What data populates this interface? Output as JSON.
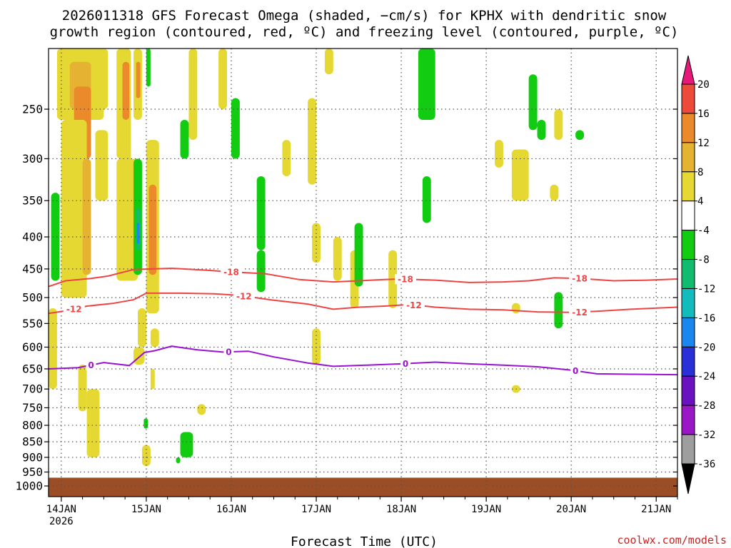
{
  "chart_data": {
    "type": "heatmap",
    "title": "2026011318 GFS Forecast Omega (shaded, −cm/s) for KPHX with dendritic snow",
    "title_line2": "growth region (contoured, red, ºC) and freezing level (contoured, purple, ºC)",
    "xlabel": "Forecast Time (UTC)",
    "credit": "coolwx.com/models",
    "y_scale": "log-pressure",
    "y_direction": "decreasing-upward",
    "ylim": [
      1040,
      200
    ],
    "xlim": [
      -0.15,
      7.25
    ],
    "grid": "dotted",
    "y_ticks": [
      250,
      300,
      350,
      400,
      450,
      500,
      550,
      600,
      650,
      700,
      750,
      800,
      850,
      900,
      950,
      1000
    ],
    "y_tick_labels": [
      "250",
      "300",
      "350",
      "400",
      "450",
      "500",
      "550",
      "600",
      "650",
      "700",
      "750",
      "800",
      "850",
      "900",
      "950",
      "1000"
    ],
    "x_ticks": [
      0,
      1,
      2,
      3,
      4,
      5,
      6,
      7
    ],
    "x_tick_labels": [
      "14JAN",
      "15JAN",
      "16JAN",
      "17JAN",
      "18JAN",
      "19JAN",
      "20JAN",
      "21JAN"
    ],
    "x_year_label": "2026",
    "colorbar": {
      "levels": [
        -36,
        -32,
        -28,
        -24,
        -20,
        -16,
        -12,
        -8,
        -4,
        4,
        8,
        12,
        16,
        20
      ],
      "labels": [
        "-36",
        "-32",
        "-28",
        "-24",
        "-20",
        "-16",
        "-12",
        "-8",
        "-4",
        "4",
        "8",
        "12",
        "16",
        "20"
      ],
      "colors": [
        "#9e9e9e",
        "#9a16c6",
        "#6a12c0",
        "#2a30d8",
        "#1a86ee",
        "#12bcbc",
        "#12bc6e",
        "#12cc12",
        "#ffffff",
        "#e6d832",
        "#e6b232",
        "#ea8a2a",
        "#ee4a3a"
      ],
      "under_color": "#000000",
      "over_color": "#e6187a"
    },
    "ground_color": "#9b4e26",
    "series": [
      {
        "name": "-18",
        "color": "#ee4444",
        "points": [
          [
            -0.15,
            480
          ],
          [
            0.05,
            470
          ],
          [
            0.35,
            466
          ],
          [
            0.55,
            462
          ],
          [
            0.85,
            451
          ],
          [
            1.3,
            449
          ],
          [
            1.7,
            452
          ],
          [
            2.0,
            455
          ],
          [
            2.4,
            458
          ],
          [
            2.8,
            468
          ],
          [
            3.2,
            472
          ],
          [
            3.5,
            470
          ],
          [
            3.8,
            468
          ],
          [
            4.0,
            467
          ],
          [
            4.4,
            469
          ],
          [
            4.8,
            473
          ],
          [
            5.2,
            472
          ],
          [
            5.5,
            470
          ],
          [
            5.8,
            465
          ],
          [
            6.1,
            466
          ],
          [
            6.5,
            470
          ],
          [
            6.9,
            469
          ],
          [
            7.25,
            467
          ]
        ],
        "labels_at": [
          2.0,
          4.05,
          6.1
        ]
      },
      {
        "name": "-12",
        "color": "#ee4444",
        "points": [
          [
            -0.15,
            530
          ],
          [
            0.05,
            525
          ],
          [
            0.3,
            516
          ],
          [
            0.6,
            511
          ],
          [
            0.85,
            504
          ],
          [
            1.0,
            492
          ],
          [
            1.4,
            492
          ],
          [
            1.8,
            493
          ],
          [
            2.1,
            496
          ],
          [
            2.5,
            505
          ],
          [
            2.9,
            512
          ],
          [
            3.2,
            522
          ],
          [
            3.5,
            518
          ],
          [
            3.8,
            516
          ],
          [
            4.1,
            513
          ],
          [
            4.4,
            518
          ],
          [
            4.8,
            522
          ],
          [
            5.2,
            523
          ],
          [
            5.6,
            527
          ],
          [
            6.0,
            528
          ],
          [
            6.3,
            526
          ],
          [
            6.7,
            522
          ],
          [
            7.25,
            518
          ]
        ],
        "labels_at": [
          0.15,
          2.15,
          4.15,
          6.1
        ]
      },
      {
        "name": "0",
        "color": "#9a12d2",
        "points": [
          [
            -0.15,
            650
          ],
          [
            0.2,
            647
          ],
          [
            0.5,
            635
          ],
          [
            0.8,
            642
          ],
          [
            0.98,
            612
          ],
          [
            1.1,
            608
          ],
          [
            1.3,
            598
          ],
          [
            1.6,
            606
          ],
          [
            1.9,
            611
          ],
          [
            2.2,
            609
          ],
          [
            2.5,
            622
          ],
          [
            2.9,
            636
          ],
          [
            3.2,
            644
          ],
          [
            3.6,
            641
          ],
          [
            4.0,
            638
          ],
          [
            4.4,
            634
          ],
          [
            4.8,
            638
          ],
          [
            5.2,
            641
          ],
          [
            5.6,
            645
          ],
          [
            6.0,
            653
          ],
          [
            6.3,
            662
          ],
          [
            6.7,
            663
          ],
          [
            7.25,
            664
          ]
        ],
        "labels_at": [
          0.35,
          1.97,
          4.05,
          6.05
        ]
      }
    ],
    "patches": [
      {
        "x0": -0.05,
        "x1": 0.5,
        "p0": 200,
        "p1": 260,
        "value": 5
      },
      {
        "x0": 0.1,
        "x1": 0.35,
        "p0": 210,
        "p1": 250,
        "value": 9
      },
      {
        "x0": 0.15,
        "x1": 0.35,
        "p0": 230,
        "p1": 300,
        "value": 14
      },
      {
        "x0": 0.0,
        "x1": 0.3,
        "p0": 260,
        "p1": 500,
        "value": 5
      },
      {
        "x0": 0.25,
        "x1": 0.35,
        "p0": 300,
        "p1": 460,
        "value": 9
      },
      {
        "x0": -0.12,
        "x1": -0.02,
        "p0": 340,
        "p1": 470,
        "value": -6
      },
      {
        "x0": -0.15,
        "x1": -0.05,
        "p0": 520,
        "p1": 700,
        "value": 5
      },
      {
        "x0": 0.2,
        "x1": 0.3,
        "p0": 640,
        "p1": 760,
        "value": 5
      },
      {
        "x0": 0.4,
        "x1": 0.55,
        "p0": 270,
        "p1": 350,
        "value": 5
      },
      {
        "x0": 0.45,
        "x1": 0.55,
        "p0": 200,
        "p1": 250,
        "value": 6
      },
      {
        "x0": 0.65,
        "x1": 0.75,
        "p0": 200,
        "p1": 300,
        "value": 6
      },
      {
        "x0": 0.7,
        "x1": 0.82,
        "p0": 200,
        "p1": 350,
        "value": 6
      },
      {
        "x0": 0.72,
        "x1": 0.8,
        "p0": 210,
        "p1": 260,
        "value": 15
      },
      {
        "x0": 0.85,
        "x1": 0.95,
        "p0": 200,
        "p1": 260,
        "value": 6
      },
      {
        "x0": 0.88,
        "x1": 0.93,
        "p0": 210,
        "p1": 240,
        "value": 15
      },
      {
        "x0": 0.65,
        "x1": 0.9,
        "p0": 300,
        "p1": 470,
        "value": 5
      },
      {
        "x0": 0.85,
        "x1": 0.95,
        "p0": 300,
        "p1": 460,
        "value": -6
      },
      {
        "x0": 0.88,
        "x1": 0.93,
        "p0": 360,
        "p1": 420,
        "value": -10
      },
      {
        "x0": 0.89,
        "x1": 0.92,
        "p0": 380,
        "p1": 410,
        "value": -18
      },
      {
        "x0": 1.0,
        "x1": 1.15,
        "p0": 280,
        "p1": 530,
        "value": 6
      },
      {
        "x0": 1.03,
        "x1": 1.12,
        "p0": 330,
        "p1": 460,
        "value": 14
      },
      {
        "x0": 0.9,
        "x1": 1.0,
        "p0": 520,
        "p1": 600,
        "value": 5
      },
      {
        "x0": 0.85,
        "x1": 0.98,
        "p0": 600,
        "p1": 640,
        "value": 5
      },
      {
        "x0": 1.05,
        "x1": 1.1,
        "p0": 650,
        "p1": 700,
        "value": 5
      },
      {
        "x0": 1.0,
        "x1": 1.05,
        "p0": 200,
        "p1": 230,
        "value": -6
      },
      {
        "x0": 1.4,
        "x1": 1.5,
        "p0": 260,
        "p1": 300,
        "value": -6
      },
      {
        "x0": 1.5,
        "x1": 1.6,
        "p0": 200,
        "p1": 280,
        "value": 5
      },
      {
        "x0": 1.85,
        "x1": 1.95,
        "p0": 200,
        "p1": 250,
        "value": 5
      },
      {
        "x0": 2.0,
        "x1": 2.1,
        "p0": 240,
        "p1": 300,
        "value": -6
      },
      {
        "x0": 2.3,
        "x1": 2.4,
        "p0": 320,
        "p1": 420,
        "value": -6
      },
      {
        "x0": 2.3,
        "x1": 2.4,
        "p0": 420,
        "p1": 490,
        "value": -6
      },
      {
        "x0": 2.6,
        "x1": 2.7,
        "p0": 280,
        "p1": 320,
        "value": 5
      },
      {
        "x0": 2.9,
        "x1": 3.0,
        "p0": 240,
        "p1": 330,
        "value": 5
      },
      {
        "x0": 2.95,
        "x1": 3.05,
        "p0": 380,
        "p1": 440,
        "value": 5
      },
      {
        "x0": 2.95,
        "x1": 3.05,
        "p0": 560,
        "p1": 640,
        "value": 5
      },
      {
        "x0": 3.1,
        "x1": 3.2,
        "p0": 200,
        "p1": 220,
        "value": 5
      },
      {
        "x0": 3.2,
        "x1": 3.3,
        "p0": 400,
        "p1": 470,
        "value": 5
      },
      {
        "x0": 3.4,
        "x1": 3.5,
        "p0": 420,
        "p1": 520,
        "value": 5
      },
      {
        "x0": 3.45,
        "x1": 3.55,
        "p0": 380,
        "p1": 480,
        "value": -6
      },
      {
        "x0": 3.85,
        "x1": 3.95,
        "p0": 420,
        "p1": 520,
        "value": 5
      },
      {
        "x0": 4.2,
        "x1": 4.4,
        "p0": 200,
        "p1": 260,
        "value": -6
      },
      {
        "x0": 4.25,
        "x1": 4.35,
        "p0": 320,
        "p1": 380,
        "value": -6
      },
      {
        "x0": 5.1,
        "x1": 5.2,
        "p0": 280,
        "p1": 310,
        "value": 5
      },
      {
        "x0": 5.3,
        "x1": 5.5,
        "p0": 290,
        "p1": 350,
        "value": 5
      },
      {
        "x0": 5.5,
        "x1": 5.6,
        "p0": 220,
        "p1": 270,
        "value": -6
      },
      {
        "x0": 5.6,
        "x1": 5.7,
        "p0": 260,
        "p1": 280,
        "value": -6
      },
      {
        "x0": 5.75,
        "x1": 5.85,
        "p0": 330,
        "p1": 350,
        "value": 5
      },
      {
        "x0": 5.8,
        "x1": 5.9,
        "p0": 250,
        "p1": 280,
        "value": 5
      },
      {
        "x0": 5.3,
        "x1": 5.4,
        "p0": 510,
        "p1": 530,
        "value": 5
      },
      {
        "x0": 5.3,
        "x1": 5.4,
        "p0": 690,
        "p1": 710,
        "value": 5
      },
      {
        "x0": 5.8,
        "x1": 5.9,
        "p0": 490,
        "p1": 560,
        "value": -6
      },
      {
        "x0": 6.05,
        "x1": 6.15,
        "p0": 270,
        "p1": 280,
        "value": -6
      },
      {
        "x0": 0.3,
        "x1": 0.45,
        "p0": 700,
        "p1": 900,
        "value": 5
      },
      {
        "x0": 1.05,
        "x1": 1.15,
        "p0": 560,
        "p1": 600,
        "value": 5
      },
      {
        "x0": 1.6,
        "x1": 1.7,
        "p0": 740,
        "p1": 770,
        "value": 5
      },
      {
        "x0": 0.95,
        "x1": 1.05,
        "p0": 860,
        "p1": 930,
        "value": 5
      },
      {
        "x0": 1.4,
        "x1": 1.55,
        "p0": 820,
        "p1": 900,
        "value": -6
      },
      {
        "x0": 0.97,
        "x1": 1.02,
        "p0": 780,
        "p1": 810,
        "value": -6
      },
      {
        "x0": 1.35,
        "x1": 1.4,
        "p0": 900,
        "p1": 920,
        "value": -6
      }
    ]
  }
}
